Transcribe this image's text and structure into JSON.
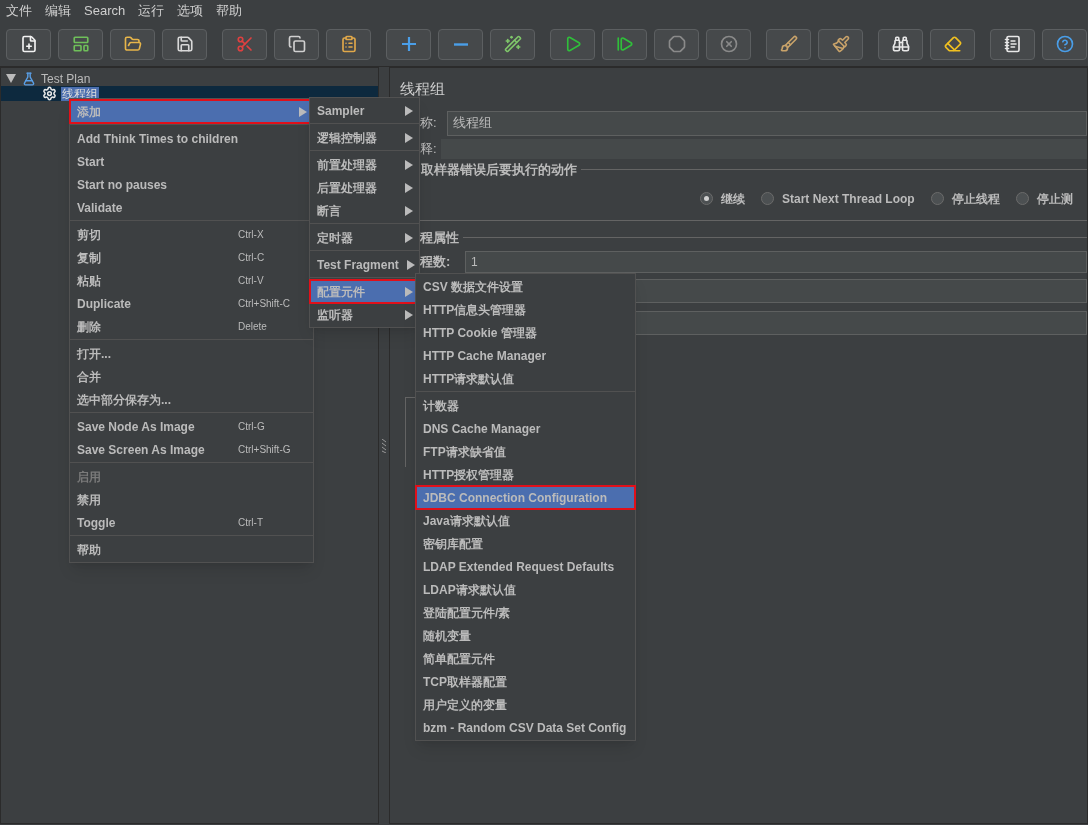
{
  "menu_bar": [
    {
      "label": "文件"
    },
    {
      "label": "编辑"
    },
    {
      "label": "Search"
    },
    {
      "label": "运行"
    },
    {
      "label": "选项"
    },
    {
      "label": "帮助"
    }
  ],
  "toolbar": [
    [
      {
        "kind": "new"
      },
      {
        "kind": "templates"
      },
      {
        "kind": "open"
      },
      {
        "kind": "save"
      }
    ],
    [
      {
        "kind": "cut"
      },
      {
        "kind": "copy"
      },
      {
        "kind": "paste"
      }
    ],
    [
      {
        "kind": "expand"
      },
      {
        "kind": "collapse"
      },
      {
        "kind": "toggle"
      }
    ],
    [
      {
        "kind": "start"
      },
      {
        "kind": "start-no-pauses"
      },
      {
        "kind": "stop"
      },
      {
        "kind": "shutdown"
      }
    ],
    [
      {
        "kind": "clear"
      },
      {
        "kind": "clear-all"
      }
    ],
    [
      {
        "kind": "search"
      },
      {
        "kind": "reset"
      }
    ],
    [
      {
        "kind": "functions"
      },
      {
        "kind": "help"
      }
    ]
  ],
  "tree": [
    {
      "label": "Test Plan",
      "kind": "plan",
      "expanded": true,
      "selected": false,
      "children": [
        {
          "label": "线程组",
          "kind": "thread-group",
          "selected": true
        }
      ]
    }
  ],
  "context_menu": {
    "sections": [
      [
        {
          "label": "添加",
          "submenu": true,
          "selected": true,
          "highlighted": true
        }
      ],
      [
        {
          "label": "Add Think Times to children"
        },
        {
          "label": "Start"
        },
        {
          "label": "Start no pauses"
        },
        {
          "label": "Validate"
        }
      ],
      [
        {
          "label": "剪切",
          "shortcut": "Ctrl-X"
        },
        {
          "label": "复制",
          "shortcut": "Ctrl-C"
        },
        {
          "label": "粘贴",
          "shortcut": "Ctrl-V"
        },
        {
          "label": "Duplicate",
          "shortcut": "Ctrl+Shift-C"
        },
        {
          "label": "删除",
          "shortcut": "Delete"
        }
      ],
      [
        {
          "label": "打开..."
        },
        {
          "label": "合并"
        },
        {
          "label": "选中部分保存为..."
        }
      ],
      [
        {
          "label": "Save Node As Image",
          "shortcut": "Ctrl-G"
        },
        {
          "label": "Save Screen As Image",
          "shortcut": "Ctrl+Shift-G"
        }
      ],
      [
        {
          "label": "启用",
          "disabled": true
        },
        {
          "label": "禁用"
        },
        {
          "label": "Toggle",
          "shortcut": "Ctrl-T"
        }
      ],
      [
        {
          "label": "帮助"
        }
      ]
    ]
  },
  "add_submenu": {
    "sections": [
      [
        {
          "label": "Sampler",
          "submenu": true
        }
      ],
      [
        {
          "label": "逻辑控制器",
          "submenu": true
        }
      ],
      [
        {
          "label": "前置处理器",
          "submenu": true
        },
        {
          "label": "后置处理器",
          "submenu": true
        },
        {
          "label": "断言",
          "submenu": true
        }
      ],
      [
        {
          "label": "定时器",
          "submenu": true
        }
      ],
      [
        {
          "label": "Test Fragment",
          "submenu": true
        }
      ],
      [
        {
          "label": "配置元件",
          "submenu": true,
          "selected": true,
          "highlighted": true
        },
        {
          "label": "监听器",
          "submenu": true
        }
      ]
    ]
  },
  "config_submenu": {
    "sections": [
      [
        {
          "label": "CSV 数据文件设置"
        },
        {
          "label": "HTTP信息头管理器"
        },
        {
          "label": "HTTP Cookie 管理器"
        },
        {
          "label": "HTTP Cache Manager"
        },
        {
          "label": "HTTP请求默认值"
        }
      ],
      [
        {
          "label": "计数器"
        },
        {
          "label": "DNS Cache Manager"
        },
        {
          "label": "FTP请求缺省值"
        },
        {
          "label": "HTTP授权管理器"
        },
        {
          "label": "JDBC Connection Configuration",
          "selected": true,
          "highlighted": true
        },
        {
          "label": "Java请求默认值"
        },
        {
          "label": "密钥库配置"
        },
        {
          "label": "LDAP Extended Request Defaults"
        },
        {
          "label": "LDAP请求默认值"
        },
        {
          "label": "登陆配置元件/素"
        },
        {
          "label": "随机变量"
        },
        {
          "label": "简单配置元件"
        },
        {
          "label": "TCP取样器配置"
        },
        {
          "label": "用户定义的变量"
        },
        {
          "label": "bzm - Random CSV Data Set Config"
        }
      ]
    ]
  },
  "panel": {
    "title": "线程组",
    "name_label": "称:",
    "name_value": "线程组",
    "comment_label": "释:",
    "error_section": "取样器错误后要执行的动作",
    "error_options": [
      {
        "label": "继续",
        "selected": true
      },
      {
        "label": "Start Next Thread Loop",
        "selected": false
      },
      {
        "label": "停止线程",
        "selected": false
      },
      {
        "label": "停止测",
        "selected": false
      }
    ],
    "thread_section": "程属性",
    "threads_label": "程数:",
    "threads_value": "1"
  }
}
